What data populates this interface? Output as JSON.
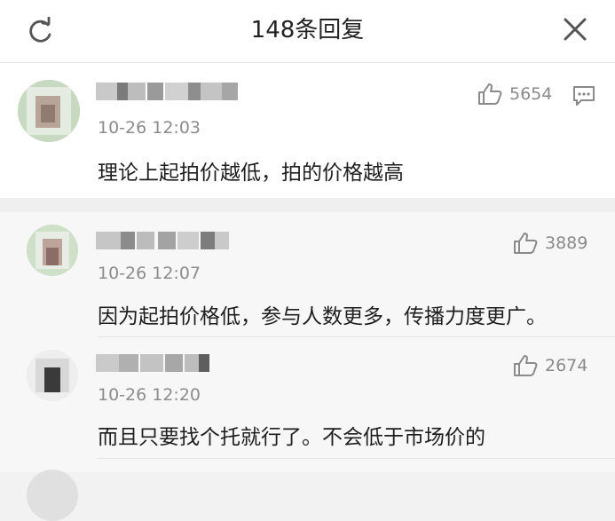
{
  "header": {
    "title": "148条回复",
    "refresh_icon": "refresh-icon",
    "close_icon": "close-icon"
  },
  "main_comment": {
    "time": "10-26 12:03",
    "likes": "5654",
    "text": "理论上起拍价越低，拍的价格越高"
  },
  "replies": [
    {
      "time": "10-26 12:07",
      "likes": "3889",
      "text": "因为起拍价格低，参与人数更多，传播力度更广。"
    },
    {
      "time": "10-26 12:20",
      "likes": "2674",
      "text": "而且只要找个托就行了。不会低于市场价的"
    }
  ],
  "colors": {
    "header_bg": "#ffffff",
    "reply_bg": "#f7f7f7",
    "muted_text": "#8c8c8c"
  }
}
